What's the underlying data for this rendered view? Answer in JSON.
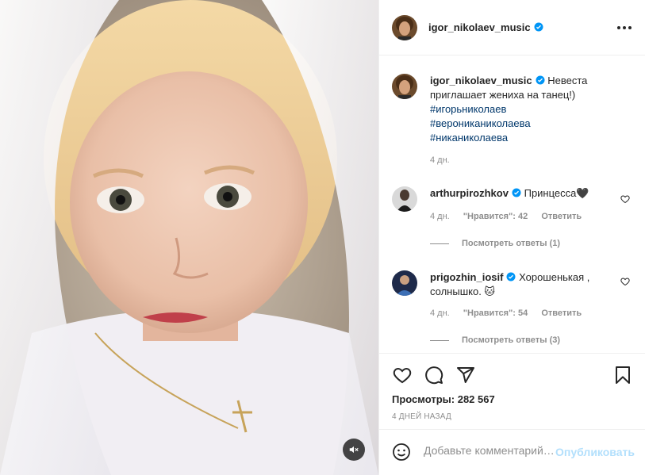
{
  "post": {
    "author": {
      "username": "igor_nikolaev_music",
      "verified": true,
      "avatar": "avatar-igor"
    },
    "caption": {
      "text": "Невеста приглашает жениха на танец!)",
      "hashtags": [
        "#игорьниколаев",
        "#верониканиколаева",
        "#никаниколаева"
      ],
      "time": "4 дн."
    },
    "comments": [
      {
        "username": "arthurpirozhkov",
        "verified": true,
        "text": "Принцесса🖤",
        "time": "4 дн.",
        "likes": "\"Нравится\": 42",
        "reply": "Ответить",
        "view_replies": "Посмотреть ответы (1)"
      },
      {
        "username": "prigozhin_iosif",
        "verified": true,
        "text": "Хорошенькая , солнышко. 🐱",
        "time": "4 дн.",
        "likes": "\"Нравится\": 54",
        "reply": "Ответить",
        "view_replies": "Посмотреть ответы (3)"
      }
    ],
    "views_label": "Просмотры:",
    "views_count": "282 567",
    "date": "4 ДНЕЙ НАЗАД",
    "add_comment_placeholder": "Добавьте комментарий…",
    "publish_label": "Опубликовать"
  },
  "icons": {
    "more": "more-horizontal-icon",
    "like": "heart-icon",
    "comment": "comment-bubble-icon",
    "share": "paper-plane-icon",
    "save": "bookmark-icon",
    "emoji": "smiley-icon",
    "mute": "speaker-muted-icon"
  },
  "colors": {
    "verified": "#0095f6",
    "link": "#00376b",
    "publish_disabled": "#b2dffc",
    "muted_text": "#8e8e8e"
  }
}
